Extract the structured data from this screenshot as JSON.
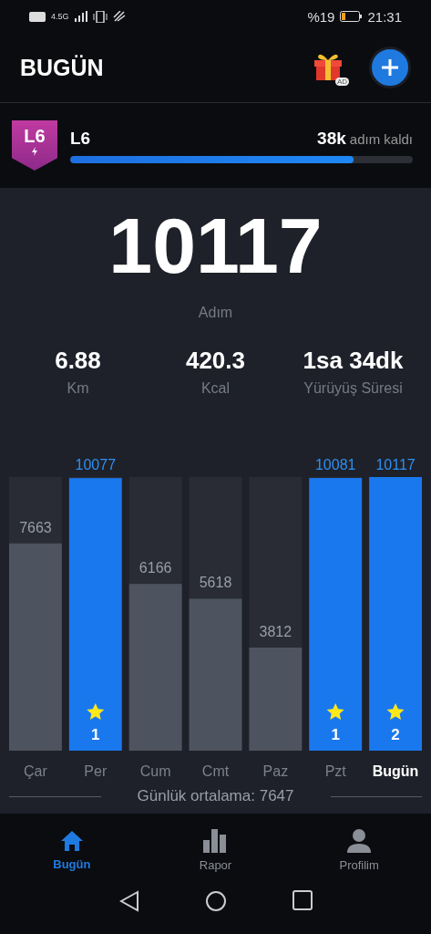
{
  "status_bar": {
    "network": "4.5G",
    "battery_text": "%19",
    "time": "21:31"
  },
  "header": {
    "title": "BUGÜN",
    "gift_badge": "AD"
  },
  "level": {
    "badge": "L6",
    "name": "L6",
    "remaining_value": "38k",
    "remaining_label": "adım kaldı",
    "level": 0.826
  },
  "today": {
    "steps": "10117",
    "steps_label": "Adım",
    "stats": [
      {
        "value": "6.88",
        "label": "Km"
      },
      {
        "value": "420.3",
        "label": "Kcal"
      },
      {
        "value": "1sa 34dk",
        "label": "Yürüyüş Süresi"
      }
    ]
  },
  "weekly": {
    "chart_data": {
      "type": "bar",
      "categories": [
        "Çar",
        "Per",
        "Cum",
        "Cmt",
        "Paz",
        "Pzt",
        "Bugün"
      ],
      "ylim": [
        0,
        10117
      ],
      "data_labels": true,
      "series": [
        {
          "color": "#1a78ee",
          "values": [
            null,
            10077,
            null,
            null,
            null,
            10081,
            10117
          ]
        },
        {
          "color": "#4e545f",
          "values": [
            7663,
            null,
            6166,
            5618,
            3812,
            null,
            null
          ]
        }
      ]
    },
    "days": [
      {
        "selected": false
      },
      {
        "selected": false,
        "star_count": "1"
      },
      {
        "selected": false
      },
      {
        "selected": false
      },
      {
        "selected": false
      },
      {
        "selected": false,
        "star_count": "1"
      },
      {
        "selected": true,
        "star_count": "2"
      }
    ]
  },
  "average": "Günlük ortalama: 7647",
  "nav": [
    {
      "label": "Bugün",
      "selected": true,
      "kind": "home"
    },
    {
      "label": "Rapor",
      "selected": false,
      "kind": "report"
    },
    {
      "label": "Profilim",
      "selected": false,
      "kind": "profile"
    }
  ]
}
